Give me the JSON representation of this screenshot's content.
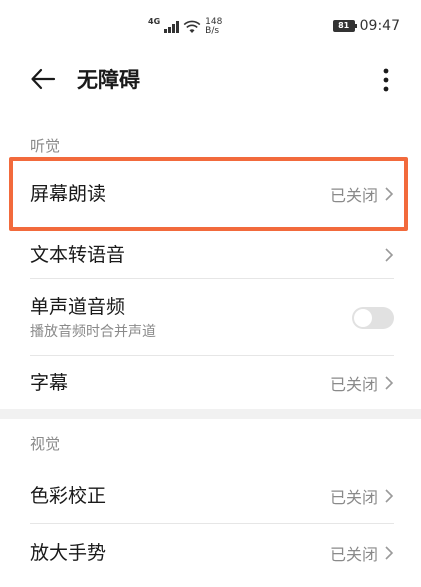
{
  "status_bar": {
    "network_type": "4G",
    "speed_value": "148",
    "speed_unit": "B/s",
    "battery": "81",
    "time": "09:47"
  },
  "header": {
    "title": "无障碍"
  },
  "sections": {
    "hearing": {
      "label": "听觉",
      "items": [
        {
          "title": "屏幕朗读",
          "value": "已关闭"
        },
        {
          "title": "文本转语音",
          "value": ""
        },
        {
          "title": "单声道音频",
          "subtitle": "播放音频时合并声道",
          "toggle_on": false
        },
        {
          "title": "字幕",
          "value": "已关闭"
        }
      ]
    },
    "vision": {
      "label": "视觉",
      "items": [
        {
          "title": "色彩校正",
          "value": "已关闭"
        },
        {
          "title": "放大手势",
          "value": "已关闭"
        }
      ]
    }
  },
  "colors": {
    "highlight": "#f26a3c",
    "toggle_off": "#e1e1e1"
  }
}
